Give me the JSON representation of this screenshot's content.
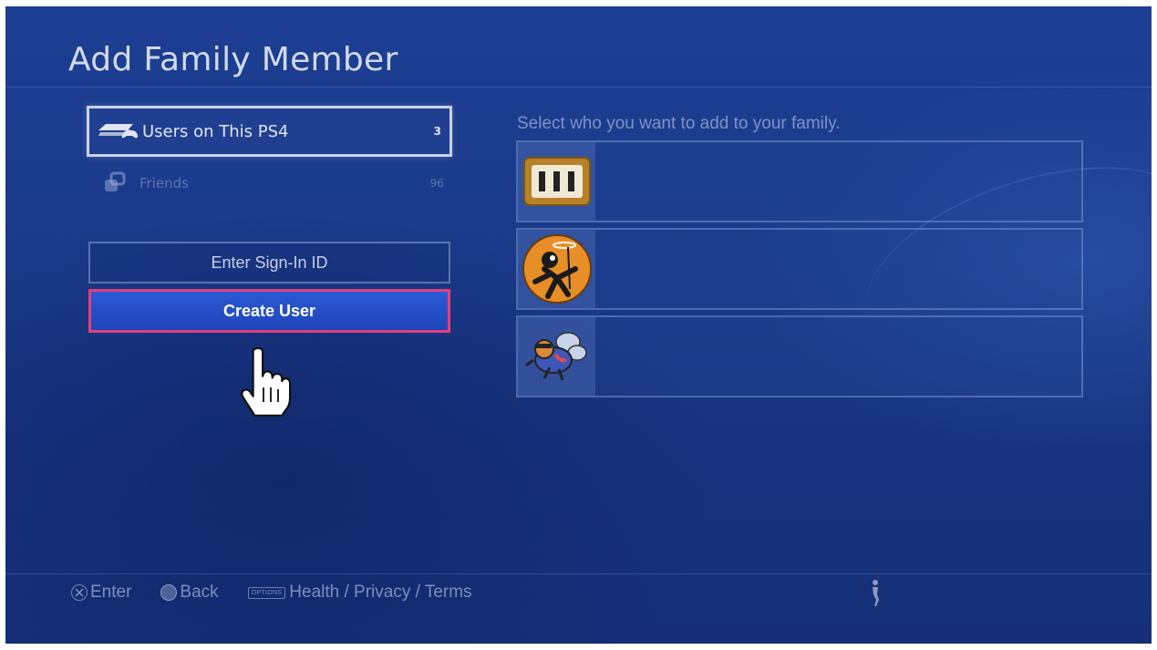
{
  "page": {
    "title": "Add Family Member"
  },
  "tabs": [
    {
      "label": "Users on This PS4",
      "count": "3",
      "icon": "ps4-console-icon",
      "selected": true
    },
    {
      "label": "Friends",
      "count": "96",
      "icon": "friends-icon",
      "selected": false
    }
  ],
  "actions": {
    "sign_in_label": "Enter Sign-In ID",
    "create_label": "Create User"
  },
  "users_panel": {
    "prompt": "Select who you want to add to your family.",
    "users": [
      {
        "avatar": "gold-box-avatar"
      },
      {
        "avatar": "orange-character-avatar"
      },
      {
        "avatar": "bee-character-avatar"
      }
    ]
  },
  "footer": {
    "enter_label": "Enter",
    "back_label": "Back",
    "options_badge": "OPTIONS",
    "terms_label": "Health / Privacy / Terms"
  },
  "colors": {
    "background": "#1a3887",
    "focus_border": "#e0417d",
    "button_blue": "#2c59d6"
  }
}
